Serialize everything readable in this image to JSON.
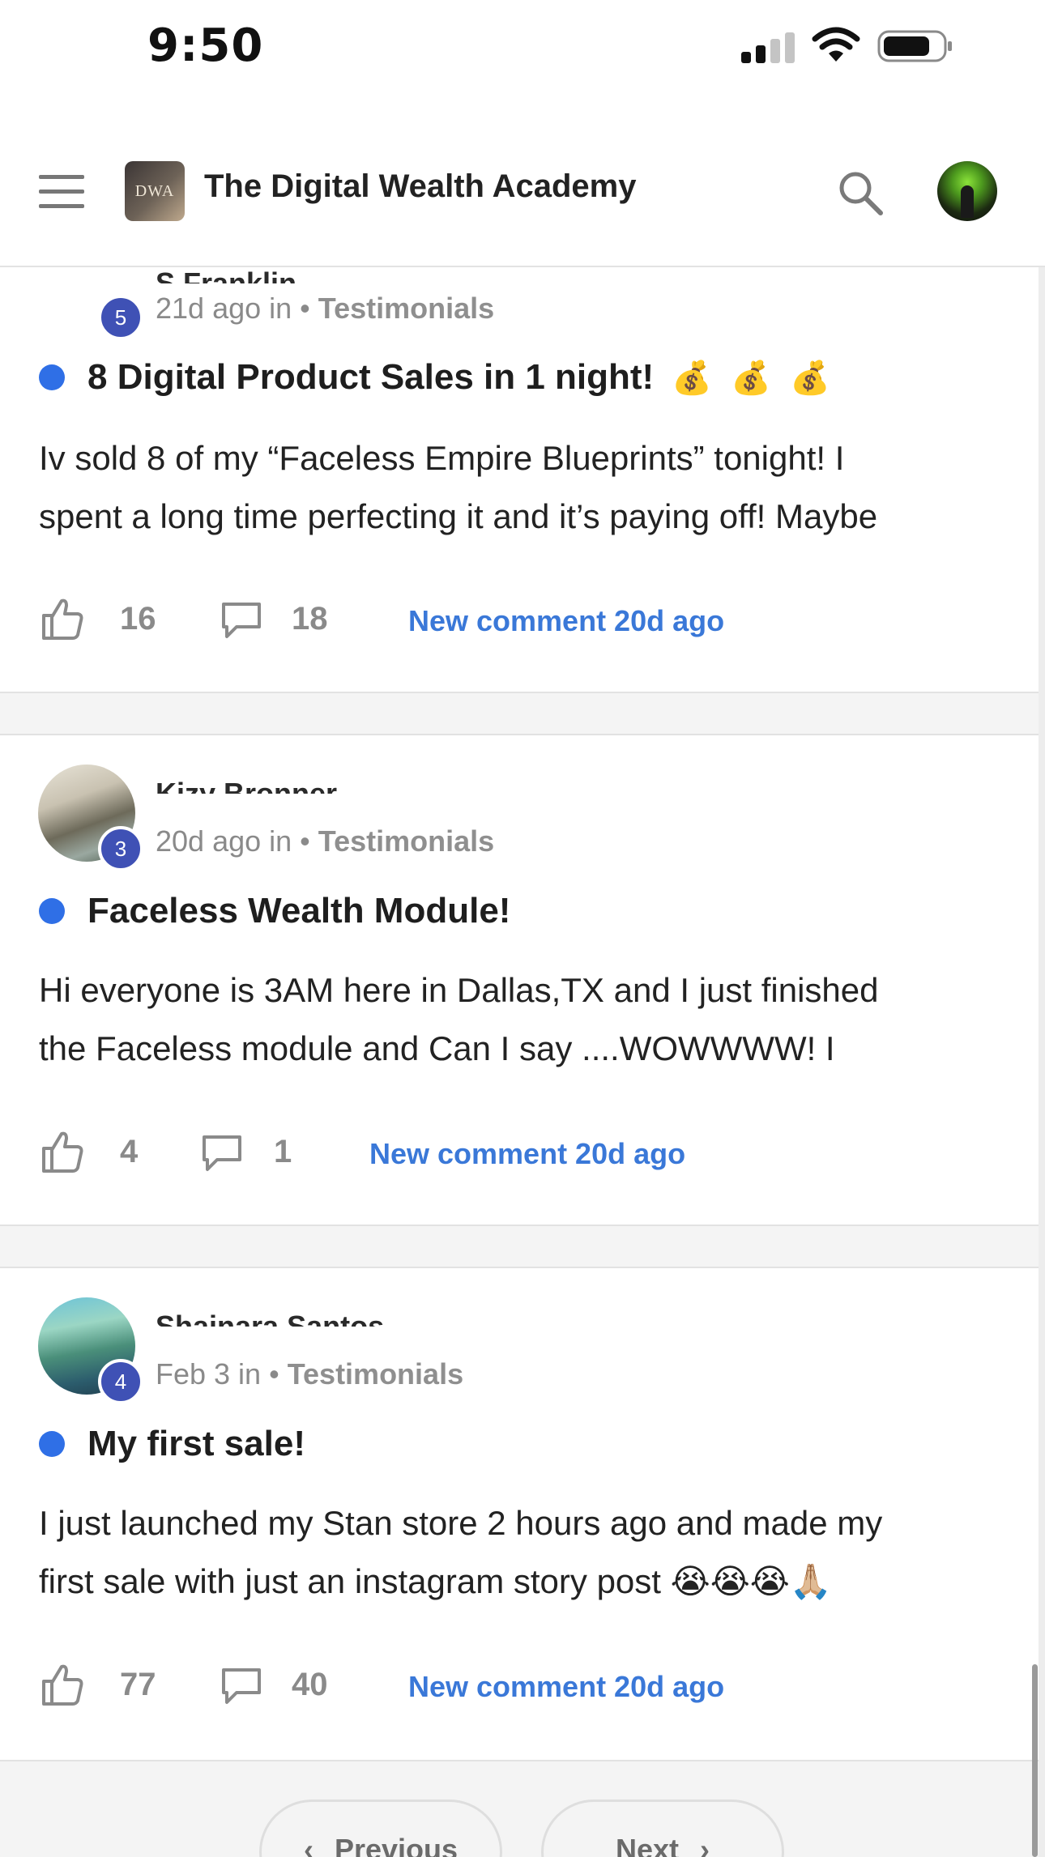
{
  "status_bar": {
    "time": "9:50"
  },
  "header": {
    "logo_text": "DWA",
    "title": "The Digital Wealth Academy"
  },
  "posts": [
    {
      "author": "S Franklin",
      "level": "5",
      "time": "21d ago in",
      "category": "Testimonials",
      "title": "8 Digital Product Sales in 1 night!",
      "title_emoji": "💰 💰 💰",
      "excerpt_line1": "Iv sold 8 of my “Faceless Empire Blueprints” tonight! I",
      "excerpt_line2": "spent a long time perfecting it and it’s paying off! Maybe",
      "likes": "16",
      "comments": "18",
      "new_comment": "New comment 20d ago"
    },
    {
      "author": "Kizy Bronner",
      "level": "3",
      "time": "20d ago in",
      "category": "Testimonials",
      "title": "Faceless Wealth Module!",
      "title_emoji": "",
      "excerpt_line1": "Hi everyone is 3AM here in Dallas,TX and I just finished",
      "excerpt_line2": "the Faceless module and Can I say ....WOWWWW! I",
      "likes": "4",
      "comments": "1",
      "new_comment": "New comment 20d ago"
    },
    {
      "author": "Shainara Santos",
      "level": "4",
      "time": "Feb 3 in",
      "category": "Testimonials",
      "title": "My first sale!",
      "title_emoji": "",
      "excerpt_line1": "I just launched my Stan store 2 hours ago and made my",
      "excerpt_line2": "first sale with just an instagram story post 😭😭😭🙏🏼",
      "likes": "77",
      "comments": "40",
      "new_comment": "New comment 20d ago"
    }
  ],
  "pagination": {
    "previous": "Previous",
    "next": "Next"
  },
  "colors": {
    "accent": "#3a78d8",
    "unread": "#2f6fe6",
    "badge": "#3f51b5"
  }
}
